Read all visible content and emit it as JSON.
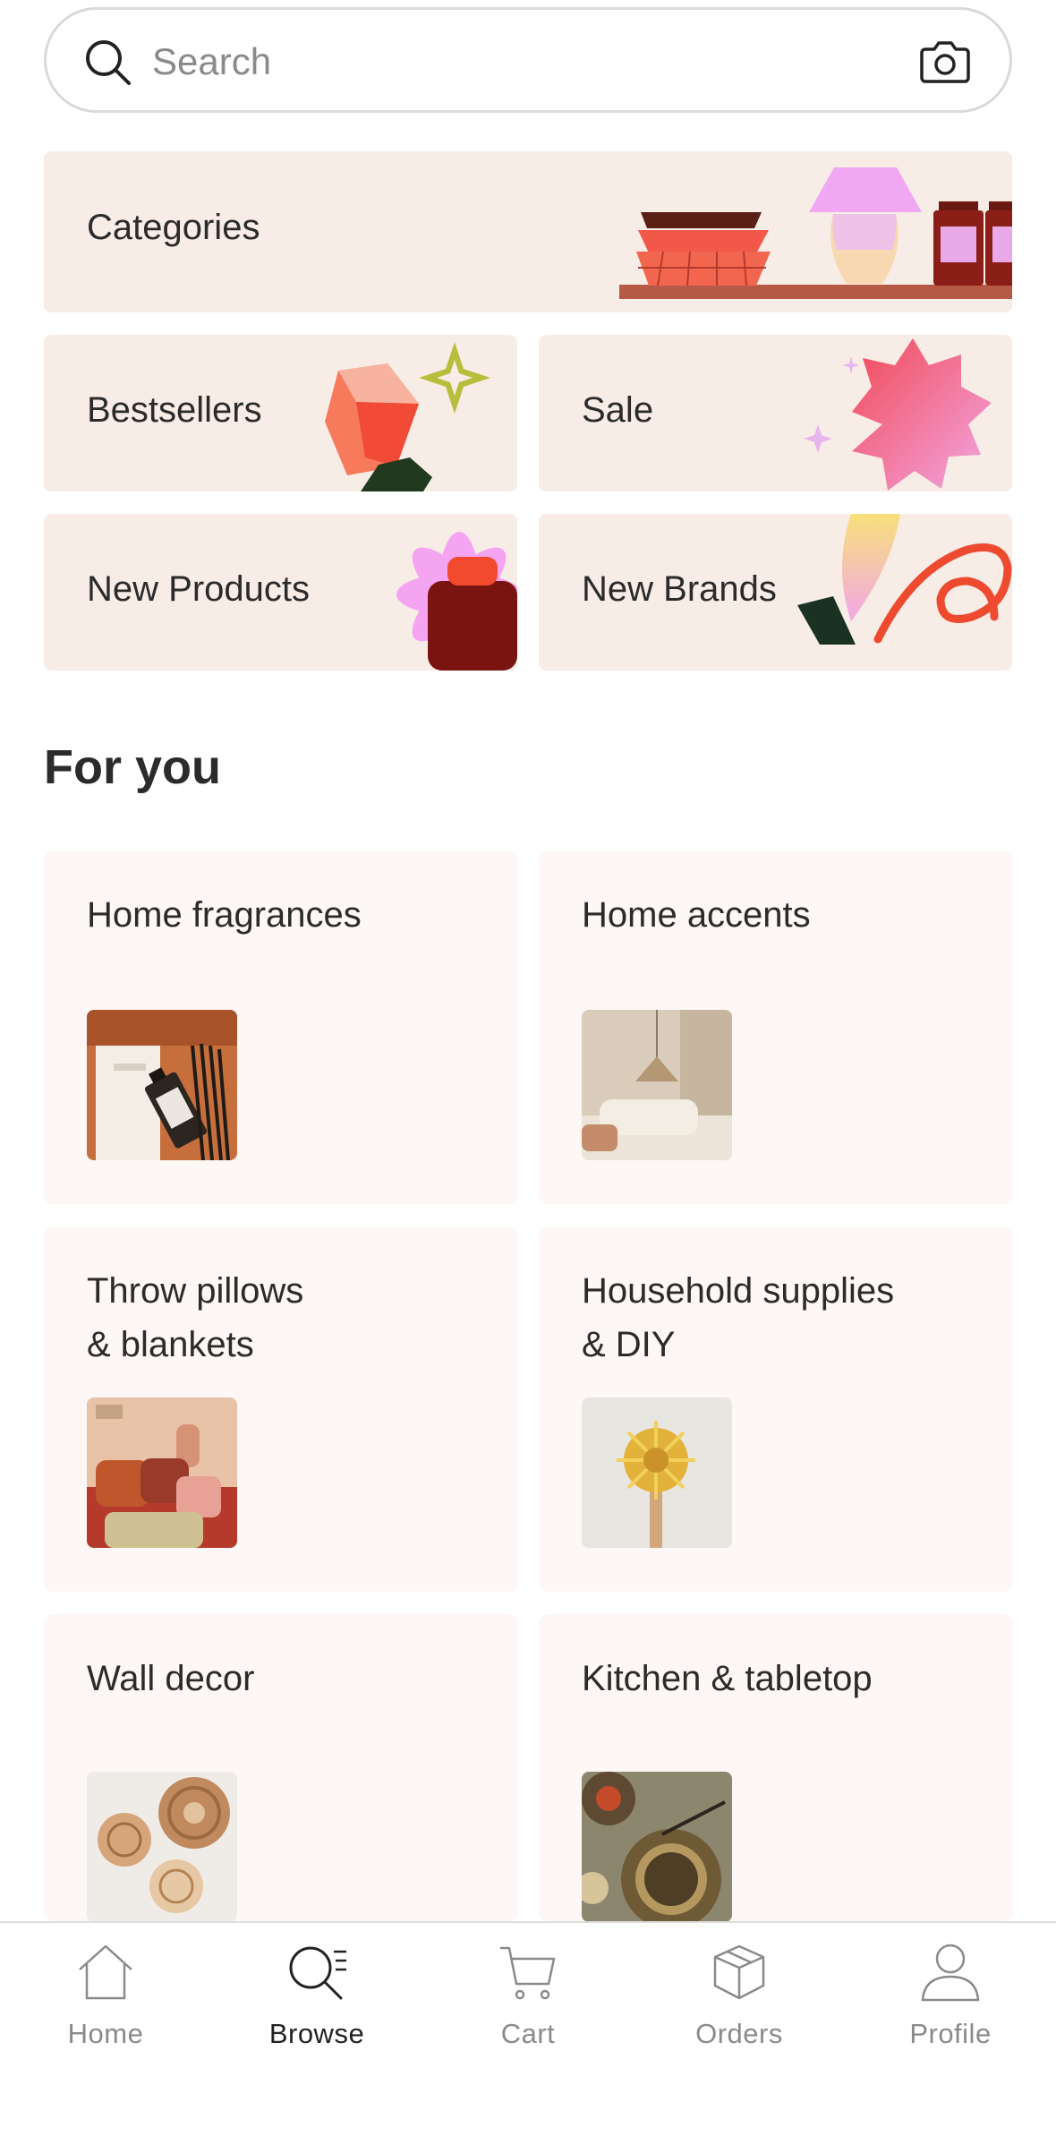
{
  "search": {
    "placeholder": "Search",
    "value": ""
  },
  "tiles": {
    "categories": "Categories",
    "bestsellers": "Bestsellers",
    "sale": "Sale",
    "new_products": "New Products",
    "new_brands": "New Brands"
  },
  "for_you": {
    "title": "For you",
    "cards": [
      {
        "label": "Home fragrances"
      },
      {
        "label": "Home accents"
      },
      {
        "label": "Throw pillows\n& blankets"
      },
      {
        "label": "Household supplies\n& DIY"
      },
      {
        "label": "Wall decor"
      },
      {
        "label": "Kitchen & tabletop"
      }
    ]
  },
  "tabbar": {
    "tabs": [
      {
        "label": "Home",
        "icon": "home-icon"
      },
      {
        "label": "Browse",
        "icon": "browse-icon",
        "active": true
      },
      {
        "label": "Cart",
        "icon": "cart-icon"
      },
      {
        "label": "Orders",
        "icon": "orders-icon"
      },
      {
        "label": "Profile",
        "icon": "profile-icon"
      }
    ]
  },
  "colors": {
    "tile_bg": "#f8ede6",
    "card_bg": "#fdf7f5",
    "active_tab": "#222222",
    "inactive_tab": "#8a8a8a"
  }
}
